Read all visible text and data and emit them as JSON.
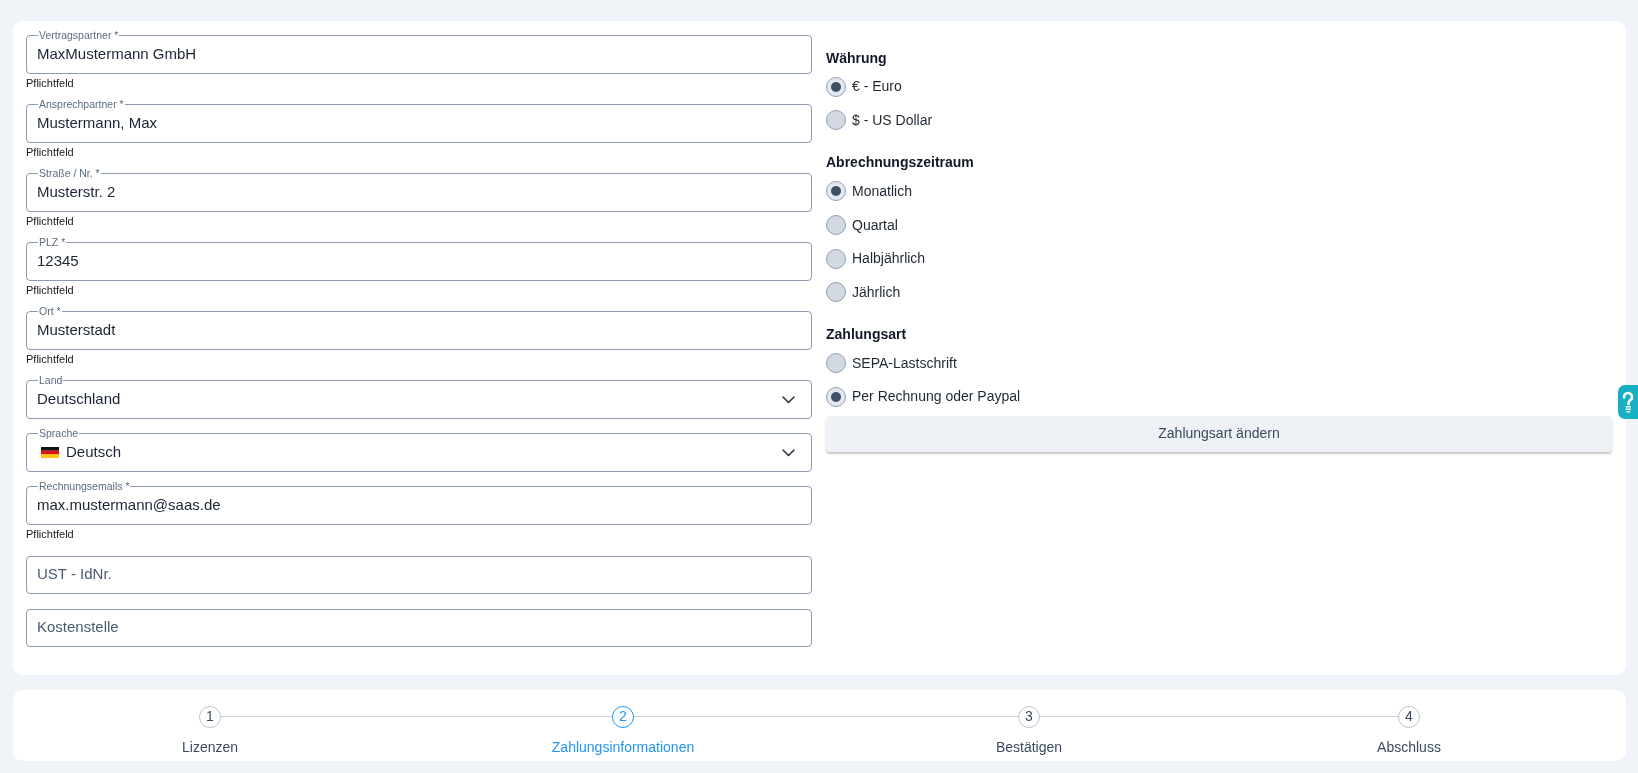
{
  "contract_form": {
    "fields": [
      {
        "kind": "text",
        "label": "Vertragspartner *",
        "value": "MaxMustermann GmbH",
        "helper": "Pflichtfeld"
      },
      {
        "kind": "text",
        "label": "Ansprechpartner *",
        "value": "Mustermann, Max",
        "helper": "Pflichtfeld"
      },
      {
        "kind": "text",
        "label": "Straße / Nr. *",
        "value": "Musterstr. 2",
        "helper": "Pflichtfeld"
      },
      {
        "kind": "text",
        "label": "PLZ *",
        "value": "12345",
        "helper": "Pflichtfeld"
      },
      {
        "kind": "text",
        "label": "Ort *",
        "value": "Musterstadt",
        "helper": "Pflichtfeld"
      },
      {
        "kind": "select",
        "label": "Land",
        "value": "Deutschland"
      },
      {
        "kind": "flag_select",
        "label": "Sprache",
        "value": "Deutsch"
      },
      {
        "kind": "text",
        "label": "Rechnungsemails *",
        "value": "max.mustermann@saas.de",
        "helper": "Pflichtfeld"
      },
      {
        "kind": "text",
        "placeholder": "UST - IdNr."
      },
      {
        "kind": "text",
        "placeholder": "Kostenstelle"
      }
    ]
  },
  "options": {
    "sections": [
      {
        "heading": "Währung",
        "choices": [
          {
            "label": "€ - Euro",
            "selected": true
          },
          {
            "label": "$ - US Dollar",
            "selected": false
          }
        ]
      },
      {
        "heading": "Abrechnungszeitraum",
        "choices": [
          {
            "label": "Monatlich",
            "selected": true
          },
          {
            "label": "Quartal",
            "selected": false
          },
          {
            "label": "Halbjährlich",
            "selected": false
          },
          {
            "label": "Jährlich",
            "selected": false
          }
        ]
      },
      {
        "heading": "Zahlungsart",
        "choices": [
          {
            "label": "SEPA-Lastschrift",
            "selected": false
          },
          {
            "label": "Per Rechnung oder Paypal",
            "selected": true
          }
        ]
      }
    ],
    "button": "Zahlungsart ändern"
  },
  "stepper": {
    "steps": [
      {
        "number": "1",
        "label": "Lizenzen",
        "selected": false
      },
      {
        "number": "2",
        "label": "Zahlungsinformationen",
        "selected": true
      },
      {
        "number": "3",
        "label": "Bestätigen",
        "selected": false
      },
      {
        "number": "4",
        "label": "Abschluss",
        "selected": false
      }
    ]
  }
}
